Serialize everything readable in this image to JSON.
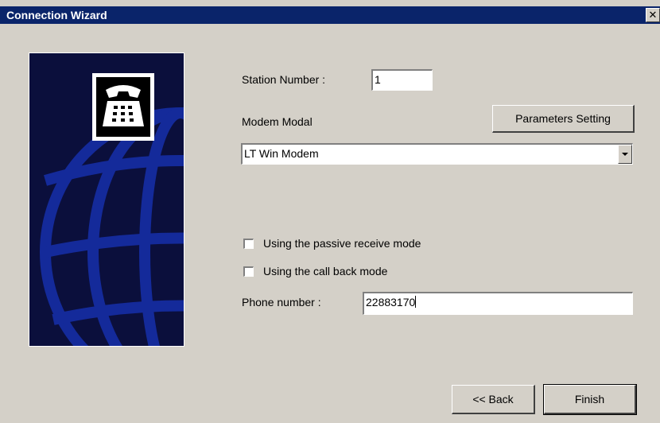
{
  "window": {
    "title": "Connection Wizard",
    "close_glyph": "✕"
  },
  "side_panel": {
    "icon": "telephone-icon",
    "background_color": "#0b0f3c",
    "globe_color": "#142a9a"
  },
  "form": {
    "station_number_label": "Station Number :",
    "station_number_value": "1",
    "modem_label": "Modem Modal",
    "modem_value": "LT Win Modem",
    "parameters_button": "Parameters Setting",
    "passive_mode_label": "Using the passive receive mode",
    "passive_mode_checked": false,
    "call_back_label": "Using the call back mode",
    "call_back_checked": false,
    "phone_label": "Phone number :",
    "phone_value": "22883170"
  },
  "footer": {
    "back_button": "<< Back",
    "finish_button": "Finish"
  }
}
